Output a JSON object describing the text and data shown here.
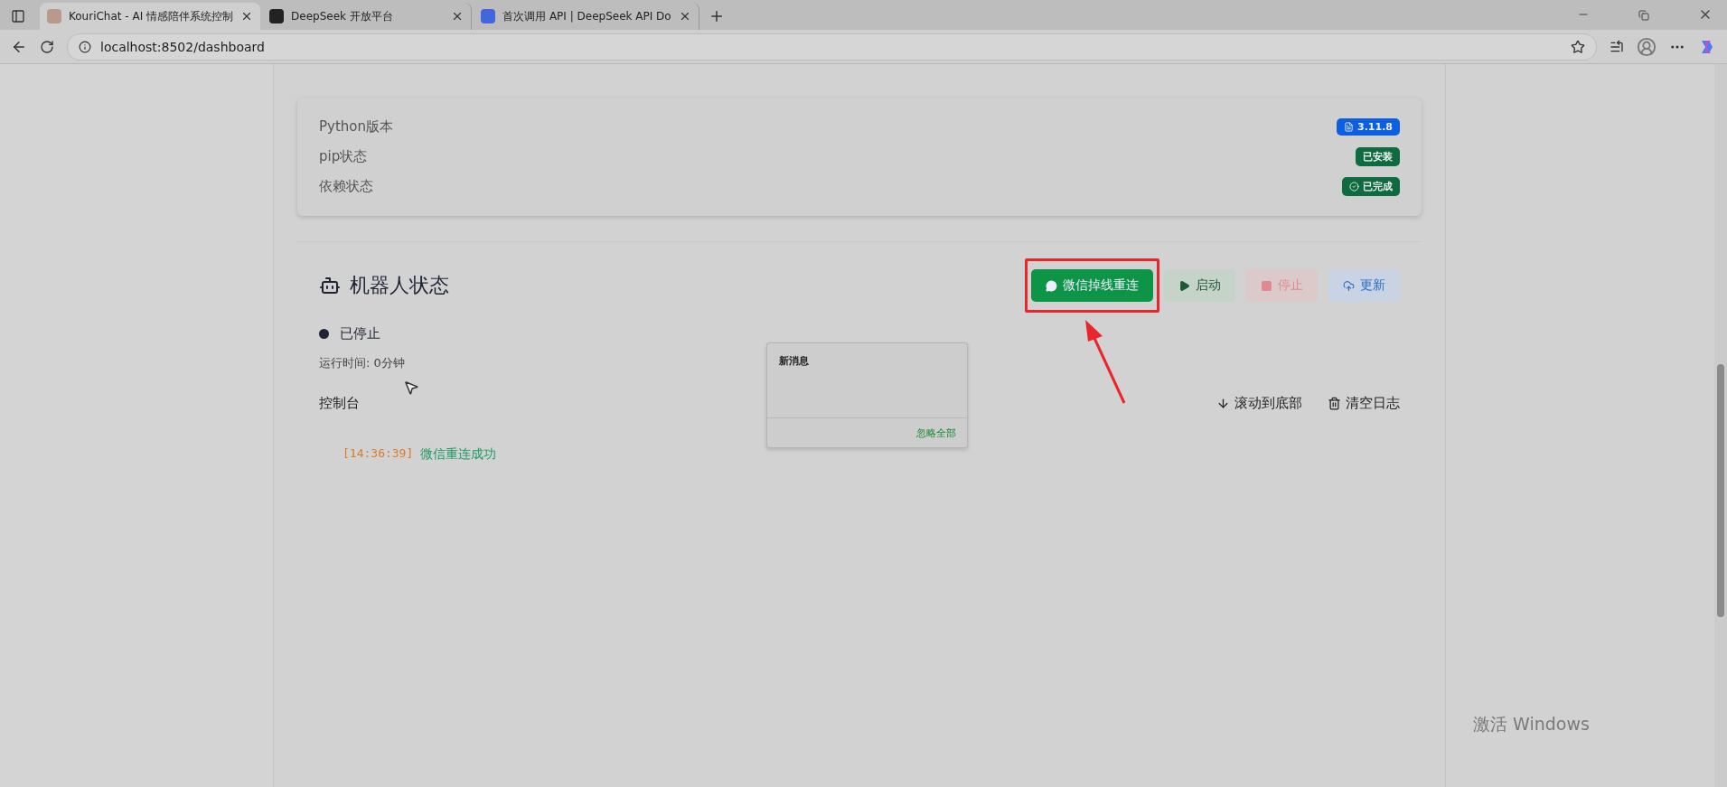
{
  "browser": {
    "tabs": [
      {
        "title": "KouriChat - AI 情感陪伴系统控制",
        "selected": true
      },
      {
        "title": "DeepSeek 开放平台",
        "selected": false
      },
      {
        "title": "首次调用 API | DeepSeek API Do",
        "selected": false
      }
    ],
    "address": "localhost:8502/dashboard"
  },
  "dependencies": {
    "rows": [
      {
        "label": "Python版本",
        "badge": "3.11.8",
        "kind": "version"
      },
      {
        "label": "pip状态",
        "badge": "已安装",
        "kind": "plain"
      },
      {
        "label": "依赖状态",
        "badge": "已完成",
        "kind": "check"
      }
    ]
  },
  "bot": {
    "title": "机器人状态",
    "buttons": [
      {
        "label": "微信掉线重连",
        "kind": "wechat",
        "highlighted": true
      },
      {
        "label": "启动",
        "kind": "start",
        "highlighted": false
      },
      {
        "label": "停止",
        "kind": "stop",
        "highlighted": false
      },
      {
        "label": "更新",
        "kind": "update",
        "highlighted": false
      }
    ],
    "status": "已停止",
    "running": false,
    "runtime": "运行时间: 0分钟",
    "console": {
      "title": "控制台",
      "actions": [
        {
          "label": "滚动到底部",
          "kind": "scroll"
        },
        {
          "label": "清空日志",
          "kind": "clear"
        }
      ],
      "logs": [
        {
          "time": "[14:36:39]",
          "message": "微信重连成功"
        }
      ]
    }
  },
  "notification": {
    "title": "新消息",
    "action": "忽略全部"
  },
  "activation": "激活 Windows"
}
